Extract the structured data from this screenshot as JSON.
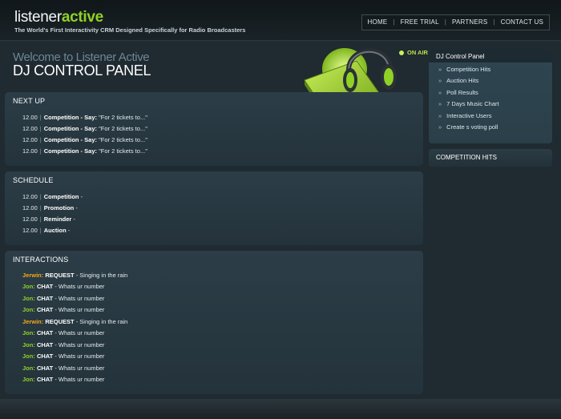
{
  "header": {
    "logo_part1": "listener",
    "logo_part2": "active",
    "tagline": "The World's First Interactivity CRM Designed Specifically for Radio Broadcasters",
    "nav": [
      "HOME",
      "FREE TRIAL",
      "PARTNERS",
      "CONTACT US"
    ]
  },
  "hero": {
    "welcome": "Welcome to Listener Active",
    "title": "DJ CONTROL PANEL",
    "on_air": "ON AIR"
  },
  "next_up": {
    "title": "NEXT UP",
    "rows": [
      {
        "time": "12.00",
        "type": "Competition - Say:",
        "text": "\"For 2 tickets to...\""
      },
      {
        "time": "12.00",
        "type": "Competition - Say:",
        "text": "\"For 2 tickets to...\""
      },
      {
        "time": "12.00",
        "type": "Competition - Say:",
        "text": "\"For 2 tickets to...\""
      },
      {
        "time": "12.00",
        "type": "Competition - Say:",
        "text": "\"For 2 tickets to...\""
      }
    ]
  },
  "schedule": {
    "title": "SCHEDULE",
    "rows": [
      {
        "time": "12.00",
        "type": "Competition",
        "text": "-"
      },
      {
        "time": "12.00",
        "type": "Promotion",
        "text": "-"
      },
      {
        "time": "12.00",
        "type": "Reminder",
        "text": "-"
      },
      {
        "time": "12.00",
        "type": "Auction",
        "text": "-"
      }
    ]
  },
  "interactions": {
    "title": "INTERACTIONS",
    "rows": [
      {
        "name": "Jerwin:",
        "kind": "REQUEST",
        "text": "- Singing in the rain",
        "color": "#f5a81a"
      },
      {
        "name": "Jon:",
        "kind": "CHAT",
        "text": "- Whats ur number",
        "color": "#8fd225"
      },
      {
        "name": "Jon:",
        "kind": "CHAT",
        "text": "- Whats ur number",
        "color": "#8fd225"
      },
      {
        "name": "Jon:",
        "kind": "CHAT",
        "text": "- Whats ur number",
        "color": "#8fd225"
      },
      {
        "name": "Jerwin:",
        "kind": "REQUEST",
        "text": "- Singing in the rain",
        "color": "#f5a81a"
      },
      {
        "name": "Jon:",
        "kind": "CHAT",
        "text": "- Whats ur number",
        "color": "#8fd225"
      },
      {
        "name": "Jon:",
        "kind": "CHAT",
        "text": "- Whats ur number",
        "color": "#8fd225"
      },
      {
        "name": "Jon:",
        "kind": "CHAT",
        "text": "- Whats ur number",
        "color": "#8fd225"
      },
      {
        "name": "Jon:",
        "kind": "CHAT",
        "text": "- Whats ur number",
        "color": "#8fd225"
      },
      {
        "name": "Jon:",
        "kind": "CHAT",
        "text": "- Whats ur number",
        "color": "#8fd225"
      }
    ]
  },
  "sidebar": {
    "title": "DJ Control Panel",
    "items": [
      "Competition Hits",
      "Auction Hits",
      "Poll Results",
      "7 Days Music Chart",
      "Interactive Users",
      "Create s voting poll"
    ],
    "arrow": "»",
    "competition_hits_title": "COMPETITION HITS"
  },
  "colors": {
    "accent_green": "#8fd225",
    "accent_orange": "#f5a81a",
    "background": "#1f2a31"
  }
}
